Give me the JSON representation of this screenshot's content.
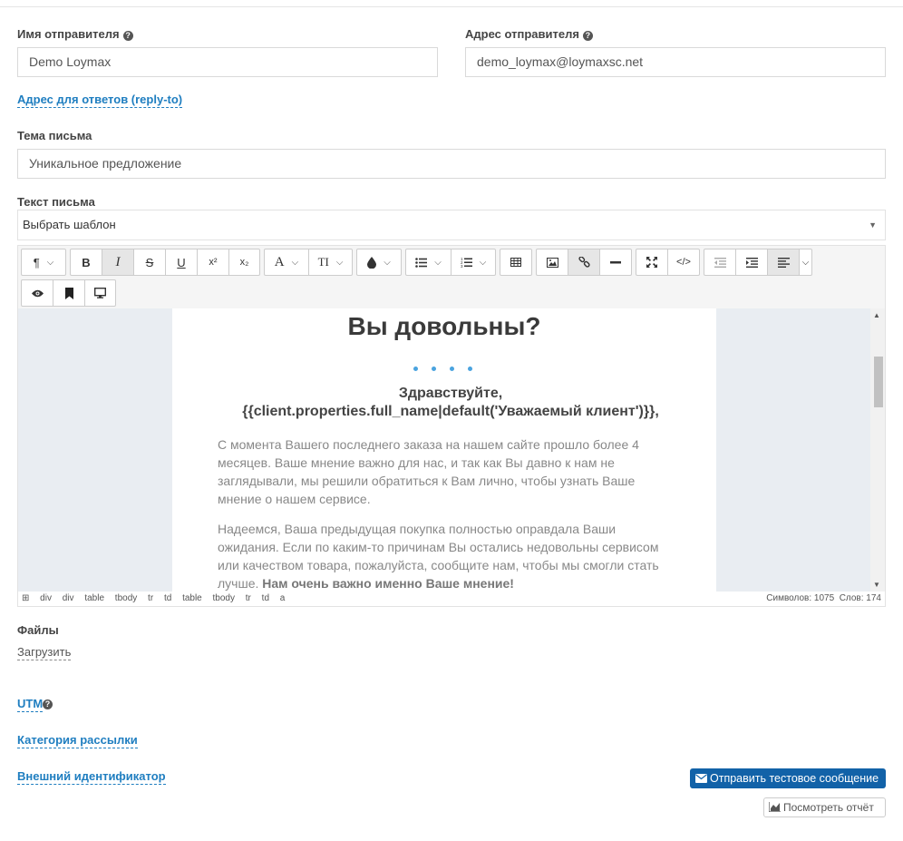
{
  "sender": {
    "name_label": "Имя отправителя",
    "name_value": "Demo Loymax",
    "address_label": "Адрес отправителя",
    "address_value": "demo_loymax@loymaxsc.net",
    "reply_to_link": "Адрес для ответов (reply-to)"
  },
  "subject": {
    "label": "Тема письма",
    "value": "Уникальное предложение"
  },
  "body": {
    "label": "Текст письма",
    "template_select": "Выбрать шаблон",
    "toolbar": {
      "bold": "B",
      "italic": "I",
      "strike": "S",
      "underline": "U",
      "superscript": "x²",
      "subscript": "x₂",
      "font_family": "A",
      "font_size": "TI"
    },
    "content": {
      "heading": "Вы довольны?",
      "greeting_line1": "Здравствуйте,",
      "greeting_line2": "{{client.properties.full_name|default('Уважаемый клиент')}},",
      "para1": "С момента Вашего последнего заказа на нашем сайте прошло более 4 месяцев. Ваше мнение важно для нас, и так как Вы давно к нам не заглядывали, мы решили обратиться к Вам лично, чтобы узнать Ваше мнение о нашем сервисе.",
      "para2": "Надеемся, Ваша предыдущая покупка полностью оправдала Ваши ожидания. Если по каким-то причинам Вы остались недовольны сервисом или качеством товара, пожалуйста, сообщите нам, чтобы мы смогли стать лучше.",
      "para2_bold": "Нам очень важно именно Ваше мнение!"
    },
    "status_path": [
      "div",
      "div",
      "table",
      "tbody",
      "tr",
      "td",
      "table",
      "tbody",
      "tr",
      "td",
      "a"
    ],
    "chars_label": "Символов: 1075",
    "words_label": "Слов: 174"
  },
  "files": {
    "label": "Файлы",
    "upload_link": "Загрузить"
  },
  "utm_link": "UTM",
  "category_link": "Категория рассылки",
  "external_id_link": "Внешний идентификатор",
  "send_test_button": "Отправить тестовое сообщение",
  "view_report_button": "Посмотреть отчёт",
  "colors": {
    "link": "#1f7ec0",
    "primary_button": "#1262a8",
    "canvas_bg": "#e9edf2"
  }
}
